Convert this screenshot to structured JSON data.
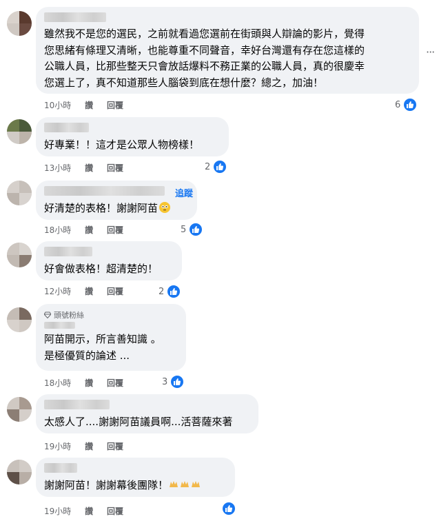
{
  "comments": [
    {
      "text": "雖然我不是您的選民，之前就看過您選前在街頭與人辯論的影片，覺得\n您思緒有條理又清晰，也能尊重不同聲音，幸好台灣還有存在您這樣的\n公職人員，比那些整天只會放話爆料不務正業的公職人員，真的很慶幸\n您選上了，真不知道那些人腦袋到底在想什麼？總之，加油！",
      "time": "10小時",
      "like": "讚",
      "reply": "回覆",
      "likes": "6"
    },
    {
      "text": "好專業！！這才是公眾人物榜樣！",
      "time": "13小時",
      "like": "讚",
      "reply": "回覆",
      "likes": "2"
    },
    {
      "text": "好清楚的表格！謝謝阿苗",
      "follow": "追蹤",
      "time": "18小時",
      "like": "讚",
      "reply": "回覆",
      "likes": "5"
    },
    {
      "text": "好會做表格！超清楚的！",
      "time": "12小時",
      "like": "讚",
      "reply": "回覆",
      "likes": "2"
    },
    {
      "badge": "頭號粉絲",
      "text": "阿苗開示，所言善知識 。\n是極優質的論述 ...",
      "time": "18小時",
      "like": "讚",
      "reply": "回覆",
      "likes": "3"
    },
    {
      "text": "太感人了....謝謝阿苗議員啊...活菩薩來著",
      "time": "19小時",
      "like": "讚",
      "reply": "回覆",
      "likes": ""
    },
    {
      "text": "謝謝阿苗！謝謝幕後團隊！",
      "time": "19小時",
      "like": "讚",
      "reply": "回覆",
      "likes": ""
    }
  ],
  "icons": {
    "like": "thumbs-up-icon",
    "more": "more-options-icon",
    "badge": "diamond-icon",
    "emoji": "flushed-face-emoji",
    "hands": "raised-hands-emoji"
  },
  "colors": {
    "bubble": "#f0f2f5",
    "link": "#1877f2",
    "meta": "#65676b"
  }
}
